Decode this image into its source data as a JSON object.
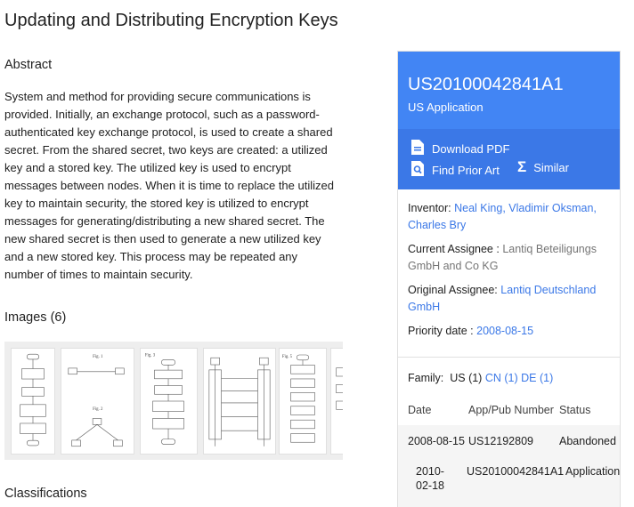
{
  "title": "Updating and Distributing Encryption Keys",
  "abstract": {
    "heading": "Abstract",
    "text": "System and method for providing secure communications is provided. Initially, an exchange protocol, such as a password-authenticated key exchange protocol, is used to create a shared secret. From the shared secret, two keys are created: a utilized key and a stored key. The utilized key is used to encrypt messages between nodes. When it is time to replace the utilized key to maintain security, the stored key is utilized to encrypt messages for generating/distributing a new shared secret. The new shared secret is then used to generate a new utilized key and a new stored key. This process may be repeated any number of times to maintain security."
  },
  "images": {
    "heading": "Images (6)"
  },
  "classifications": {
    "heading": "Classifications"
  },
  "sidebar": {
    "pub_number": "US20100042841A1",
    "pub_type": "US Application",
    "download_pdf": "Download PDF",
    "find_prior_art": "Find Prior Art",
    "similar": "Similar",
    "inventor_label": "Inventor:",
    "inventors": "Neal King, Vladimir Oksman, Charles Bry",
    "current_assignee_label": "Current Assignee :",
    "current_assignee": "Lantiq Beteiligungs GmbH and Co KG",
    "original_assignee_label": "Original Assignee:",
    "original_assignee": "Lantiq Deutschland GmbH",
    "priority_label": "Priority date :",
    "priority_date": "2008-08-15",
    "family_label": "Family:",
    "family_us": "US (1)",
    "family_cn": "CN (1)",
    "family_de": "DE (1)",
    "col_date": "Date",
    "col_app": "App/Pub Number",
    "col_status": "Status",
    "rows": [
      {
        "date": "2008-08-15",
        "number": "US12192809",
        "status": "Abandoned"
      },
      {
        "date_a": "2010-",
        "date_b": "02-18",
        "number": "US20100042841A1",
        "status": "Application"
      }
    ],
    "colors": {
      "header": "#4285f4",
      "actions": "#3b78e7",
      "link": "#3b78e7"
    }
  }
}
